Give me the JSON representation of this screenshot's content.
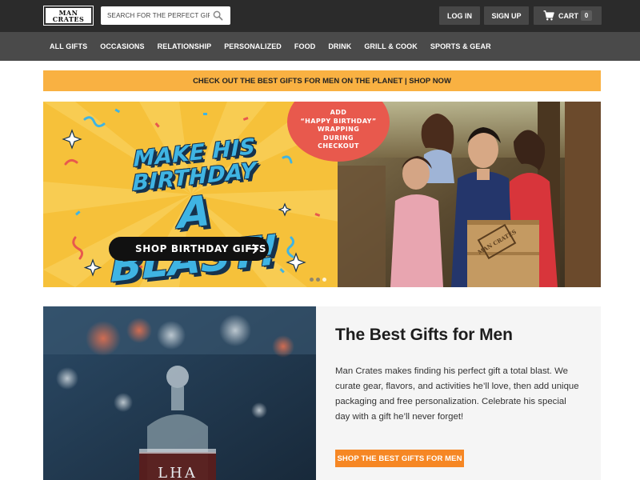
{
  "header": {
    "logo": {
      "line1": "MAN",
      "line2": "CRATES"
    },
    "search": {
      "placeholder": "SEARCH FOR THE PERFECT GIFT",
      "icon": "search-icon"
    },
    "login_label": "LOG IN",
    "signup_label": "SIGN UP",
    "cart": {
      "label": "CART",
      "count": "0",
      "icon": "cart-icon"
    }
  },
  "nav": {
    "items": [
      {
        "label": "ALL GIFTS"
      },
      {
        "label": "OCCASIONS"
      },
      {
        "label": "RELATIONSHIP"
      },
      {
        "label": "PERSONALIZED"
      },
      {
        "label": "FOOD"
      },
      {
        "label": "DRINK"
      },
      {
        "label": "GRILL & COOK"
      },
      {
        "label": "SPORTS & GEAR"
      }
    ]
  },
  "promo": {
    "text": "CHECK OUT THE BEST GIFTS FOR MEN ON THE PLANET | SHOP NOW"
  },
  "hero": {
    "title_line1": "MAKE HIS BIRTHDAY",
    "title_line2": "A BLAST!",
    "cta_label": "SHOP BIRTHDAY GIFTS",
    "badge": {
      "line1": "ADD",
      "line2": "“HAPPY BIRTHDAY”",
      "line3": "WRAPPING",
      "line4": "DURING",
      "line5": "CHECKOUT"
    },
    "crate_label": "MAN CRATES",
    "slides": {
      "total": 3,
      "active": 3
    }
  },
  "feature": {
    "title": "The Best Gifts for Men",
    "body": "Man Crates makes finding his perfect gift a total blast. We curate gear, flavors, and activities he’ll love, then add unique packaging and free personalization. Celebrate his special day with a gift he’ll never forget!",
    "button_label": "SHOP THE BEST GIFTS FOR MEN",
    "decanter_engraving": "LHA"
  },
  "colors": {
    "topbar": "#2b2b2b",
    "navbar": "#4a4a4a",
    "promo": "#f9b142",
    "hero_bg": "#f6c13a",
    "hero_title": "#3fb4e3",
    "badge": "#e8594d",
    "cta_orange": "#f68724"
  }
}
